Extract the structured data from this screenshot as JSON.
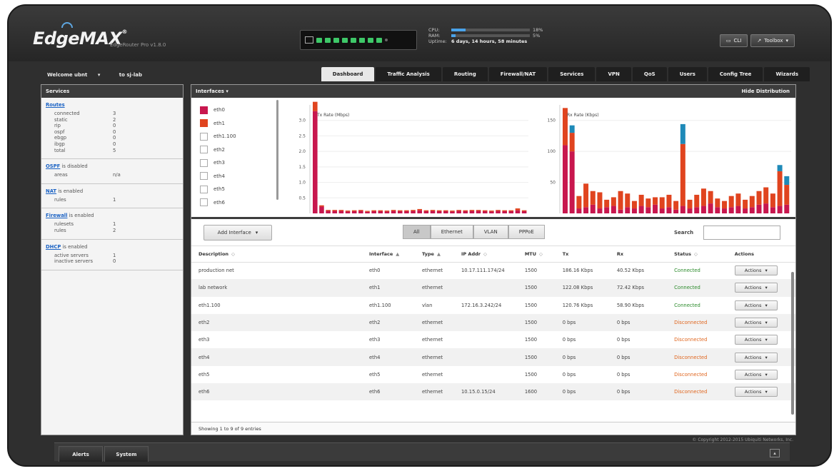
{
  "header": {
    "brand": "EdgeMAX",
    "model": "EdgeRouter Pro v1.8.0",
    "cpu_label": "CPU:",
    "cpu_value": "18%",
    "cpu_fraction": 0.18,
    "ram_label": "RAM:",
    "ram_value": "5%",
    "ram_fraction": 0.05,
    "uptime_label": "Uptime:",
    "uptime_value": "6 days, 14 hours, 58 minutes",
    "cli_label": "CLI",
    "toolbox_label": "Toolbox"
  },
  "nav": {
    "welcome": "Welcome ubnt",
    "host": "to sj-lab",
    "tabs": [
      "Dashboard",
      "Traffic Analysis",
      "Routing",
      "Firewall/NAT",
      "Services",
      "VPN",
      "QoS",
      "Users",
      "Config Tree",
      "Wizards"
    ],
    "active_tab": "Dashboard"
  },
  "sidebar": {
    "title": "Services",
    "routes": {
      "title": "Routes",
      "rows": [
        {
          "k": "connected",
          "v": "3"
        },
        {
          "k": "static",
          "v": "2"
        },
        {
          "k": "rip",
          "v": "0"
        },
        {
          "k": "ospf",
          "v": "0"
        },
        {
          "k": "ebgp",
          "v": "0"
        },
        {
          "k": "ibgp",
          "v": "0"
        },
        {
          "k": "total",
          "v": "5"
        }
      ]
    },
    "ospf": {
      "link": "OSPF",
      "status": " is disabled",
      "rows": [
        {
          "k": "areas",
          "v": "n/a"
        }
      ]
    },
    "nat": {
      "link": "NAT",
      "status": " is enabled",
      "rows": [
        {
          "k": "rules",
          "v": "1"
        }
      ]
    },
    "firewall": {
      "link": "Firewall",
      "status": " is enabled",
      "rows": [
        {
          "k": "rulesets",
          "v": "1"
        },
        {
          "k": "rules",
          "v": "2"
        }
      ]
    },
    "dhcp": {
      "link": "DHCP",
      "status": " is enabled",
      "rows": [
        {
          "k": "active servers",
          "v": "1"
        },
        {
          "k": "inactive servers",
          "v": "0"
        }
      ]
    }
  },
  "main": {
    "title": "Interfaces",
    "distribution_label": "Hide Distribution",
    "legend": [
      {
        "name": "eth0",
        "color": "#c8174e",
        "filled": true
      },
      {
        "name": "eth1",
        "color": "#e0441f",
        "filled": true
      },
      {
        "name": "eth1.100",
        "color": "#ffffff",
        "filled": false
      },
      {
        "name": "eth2",
        "color": "#ffffff",
        "filled": false
      },
      {
        "name": "eth3",
        "color": "#ffffff",
        "filled": false
      },
      {
        "name": "eth4",
        "color": "#ffffff",
        "filled": false
      },
      {
        "name": "eth5",
        "color": "#ffffff",
        "filled": false
      },
      {
        "name": "eth6",
        "color": "#ffffff",
        "filled": false
      }
    ],
    "add_interface": "Add Interface",
    "filters": [
      "All",
      "Ethernet",
      "VLAN",
      "PPPoE"
    ],
    "active_filter": "All",
    "search_label": "Search",
    "columns": [
      "Description",
      "Interface",
      "Type",
      "IP Addr",
      "MTU",
      "Tx",
      "Rx",
      "Status",
      "Actions"
    ],
    "rows": [
      {
        "desc": "production net",
        "iface": "eth0",
        "type": "ethernet",
        "ip": "10.17.111.174/24",
        "mtu": "1500",
        "tx": "186.16 Kbps",
        "rx": "40.52 Kbps",
        "status": "Connected"
      },
      {
        "desc": "lab network",
        "iface": "eth1",
        "type": "ethernet",
        "ip": "",
        "mtu": "1500",
        "tx": "122.08 Kbps",
        "rx": "72.42 Kbps",
        "status": "Connected"
      },
      {
        "desc": "eth1.100",
        "iface": "eth1.100",
        "type": "vlan",
        "ip": "172.16.3.242/24",
        "mtu": "1500",
        "tx": "120.76 Kbps",
        "rx": "58.90 Kbps",
        "status": "Connected"
      },
      {
        "desc": "eth2",
        "iface": "eth2",
        "type": "ethernet",
        "ip": "",
        "mtu": "1500",
        "tx": "0 bps",
        "rx": "0 bps",
        "status": "Disconnected"
      },
      {
        "desc": "eth3",
        "iface": "eth3",
        "type": "ethernet",
        "ip": "",
        "mtu": "1500",
        "tx": "0 bps",
        "rx": "0 bps",
        "status": "Disconnected"
      },
      {
        "desc": "eth4",
        "iface": "eth4",
        "type": "ethernet",
        "ip": "",
        "mtu": "1500",
        "tx": "0 bps",
        "rx": "0 bps",
        "status": "Disconnected"
      },
      {
        "desc": "eth5",
        "iface": "eth5",
        "type": "ethernet",
        "ip": "",
        "mtu": "1500",
        "tx": "0 bps",
        "rx": "0 bps",
        "status": "Disconnected"
      },
      {
        "desc": "eth6",
        "iface": "eth6",
        "type": "ethernet",
        "ip": "10.15.0.15/24",
        "mtu": "1600",
        "tx": "0 bps",
        "rx": "0 bps",
        "status": "Disconnected"
      }
    ],
    "actions_label": "Actions",
    "showing": "Showing 1 to 9 of 9 entries"
  },
  "chart_data": [
    {
      "type": "bar",
      "title": "Tx Rate (Mbps)",
      "ylim": [
        0,
        3.5
      ],
      "yticks": [
        "3.0",
        "2.5",
        "2.0",
        "1.5",
        "1.0",
        "0.5"
      ],
      "series": [
        {
          "name": "eth0",
          "color": "#c8174e",
          "values": [
            3.3,
            0.22,
            0.08,
            0.08,
            0.08,
            0.06,
            0.07,
            0.08,
            0.05,
            0.07,
            0.07,
            0.06,
            0.08,
            0.07,
            0.07,
            0.08,
            0.1,
            0.07,
            0.08,
            0.07,
            0.07,
            0.06,
            0.08,
            0.07,
            0.08,
            0.08,
            0.07,
            0.06,
            0.08,
            0.07,
            0.07,
            0.1,
            0.07
          ]
        },
        {
          "name": "eth1",
          "color": "#e0441f",
          "values": [
            0.3,
            0.04,
            0.03,
            0.03,
            0.03,
            0.03,
            0.03,
            0.03,
            0.03,
            0.03,
            0.03,
            0.03,
            0.03,
            0.03,
            0.03,
            0.03,
            0.04,
            0.03,
            0.03,
            0.03,
            0.03,
            0.03,
            0.03,
            0.03,
            0.03,
            0.03,
            0.03,
            0.03,
            0.03,
            0.03,
            0.03,
            0.06,
            0.03
          ]
        }
      ]
    },
    {
      "type": "bar",
      "title": "Rx Rate (Kbps)",
      "ylim": [
        0,
        175
      ],
      "yticks": [
        "150",
        "100",
        "50"
      ],
      "series": [
        {
          "name": "eth0",
          "color": "#c8174e",
          "values": [
            110,
            100,
            8,
            10,
            14,
            8,
            10,
            12,
            6,
            10,
            8,
            12,
            10,
            14,
            8,
            10,
            6,
            12,
            8,
            10,
            12,
            16,
            10,
            8,
            10,
            12,
            8,
            10,
            14,
            16,
            10,
            12,
            14
          ]
        },
        {
          "name": "eth1",
          "color": "#e0441f",
          "values": [
            60,
            30,
            20,
            38,
            22,
            26,
            12,
            14,
            30,
            22,
            12,
            18,
            14,
            12,
            18,
            20,
            14,
            100,
            14,
            20,
            28,
            20,
            14,
            12,
            18,
            20,
            14,
            18,
            22,
            26,
            22,
            56,
            32
          ]
        },
        {
          "name": "eth1.100",
          "color": "#1f8ab8",
          "values": [
            0,
            12,
            0,
            0,
            0,
            0,
            0,
            0,
            0,
            0,
            0,
            0,
            0,
            0,
            0,
            0,
            0,
            32,
            0,
            0,
            0,
            0,
            0,
            0,
            0,
            0,
            0,
            0,
            0,
            0,
            0,
            10,
            14
          ]
        }
      ]
    }
  ],
  "footer": {
    "copyright": "© Copyright 2012-2015 Ubiquiti Networks, Inc.",
    "tabs": [
      "Alerts",
      "System"
    ]
  }
}
